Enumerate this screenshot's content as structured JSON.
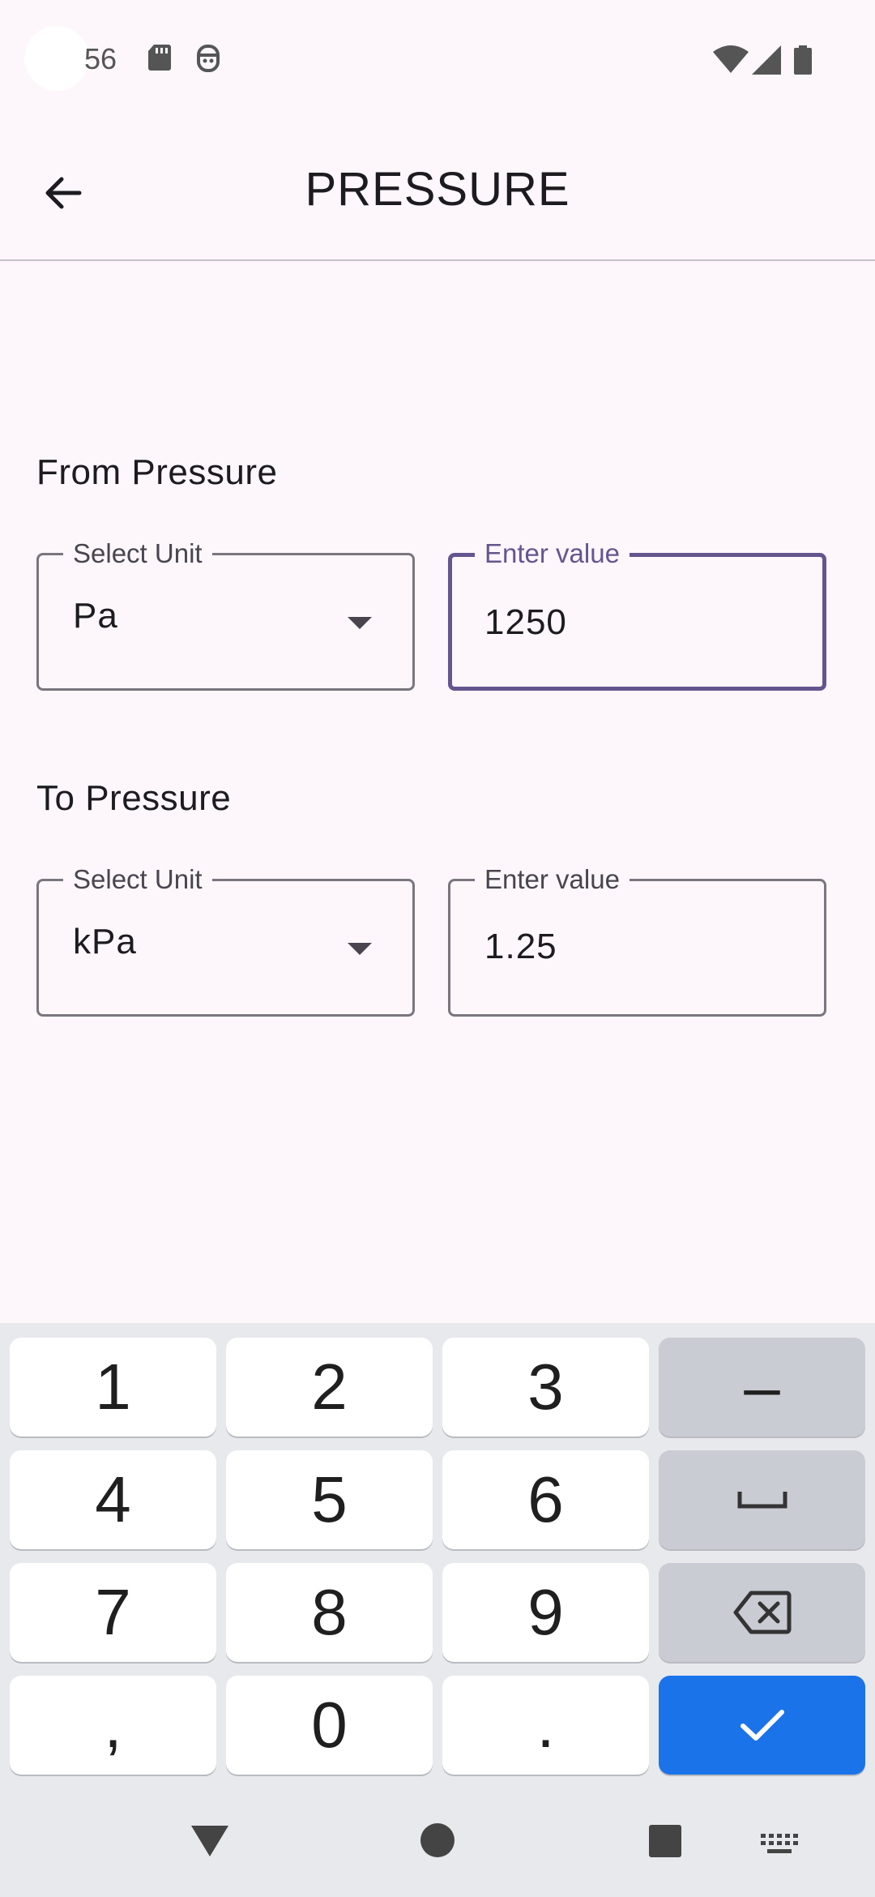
{
  "status_bar": {
    "time": "56"
  },
  "app_bar": {
    "title": "PRESSURE"
  },
  "from": {
    "section_label": "From Pressure",
    "unit_field": {
      "legend": "Select Unit",
      "value": "Pa"
    },
    "value_field": {
      "legend": "Enter value",
      "value": "1250"
    }
  },
  "to": {
    "section_label": "To Pressure",
    "unit_field": {
      "legend": "Select Unit",
      "value": "kPa"
    },
    "value_field": {
      "legend": "Enter value",
      "value": "1.25"
    }
  },
  "keyboard": {
    "keys": {
      "k1": "1",
      "k2": "2",
      "k3": "3",
      "minus": "–",
      "k4": "4",
      "k5": "5",
      "k6": "6",
      "k7": "7",
      "k8": "8",
      "k9": "9",
      "comma": ",",
      "k0": "0",
      "period": "."
    },
    "enter_color": "#1a73e8"
  },
  "colors": {
    "accent": "#65558f",
    "background": "#fdf7fb"
  }
}
